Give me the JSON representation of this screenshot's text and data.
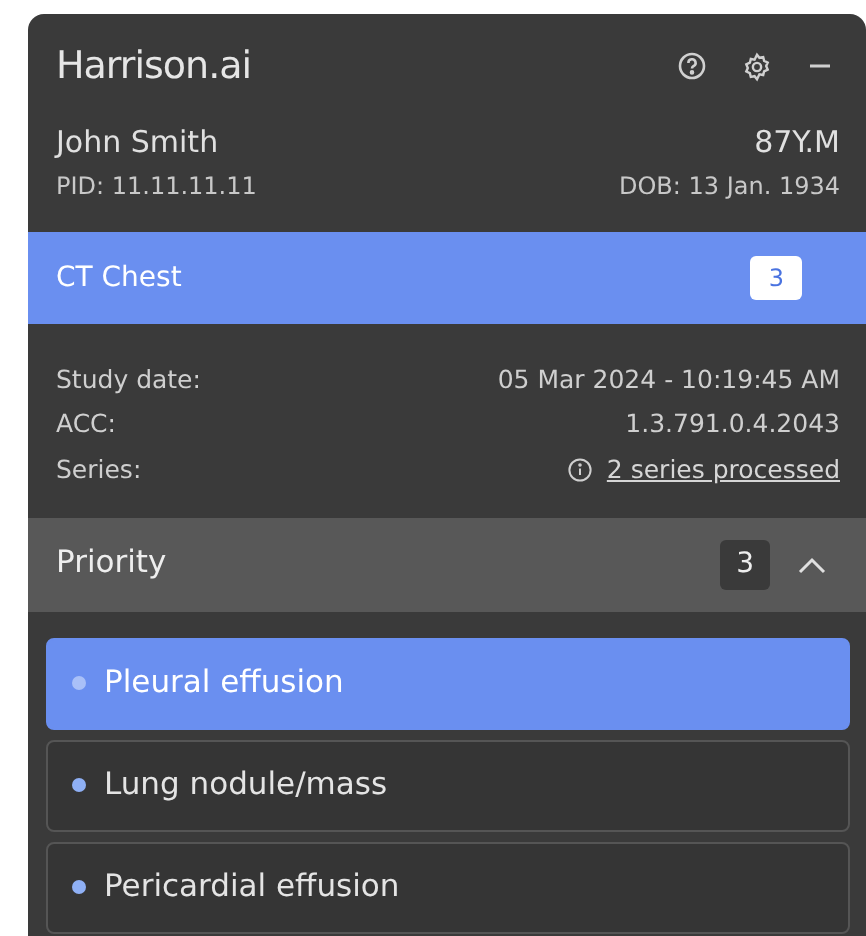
{
  "app": {
    "logo": "Harrison.ai"
  },
  "patient": {
    "name": "John Smith",
    "age_sex": "87Y.M",
    "pid": "PID: 11.11.11.11",
    "dob": "DOB: 13 Jan. 1934"
  },
  "study": {
    "title": "CT Chest",
    "count": "3",
    "selected": true
  },
  "details": [
    {
      "label": "Study date:",
      "value": "05 Mar 2024 - 10:19:45 AM",
      "kind": "text"
    },
    {
      "label": "ACC:",
      "value": "1.3.791.0.4.2043",
      "kind": "text"
    },
    {
      "label": "Series:",
      "value": "2 series processed",
      "kind": "link"
    }
  ],
  "priority": {
    "title": "Priority",
    "count": "3",
    "expanded": true,
    "findings": [
      {
        "label": "Pleural effusion",
        "selected": true
      },
      {
        "label": "Lung nodule/mass",
        "selected": false
      },
      {
        "label": "Pericardial effusion",
        "selected": false
      }
    ]
  }
}
